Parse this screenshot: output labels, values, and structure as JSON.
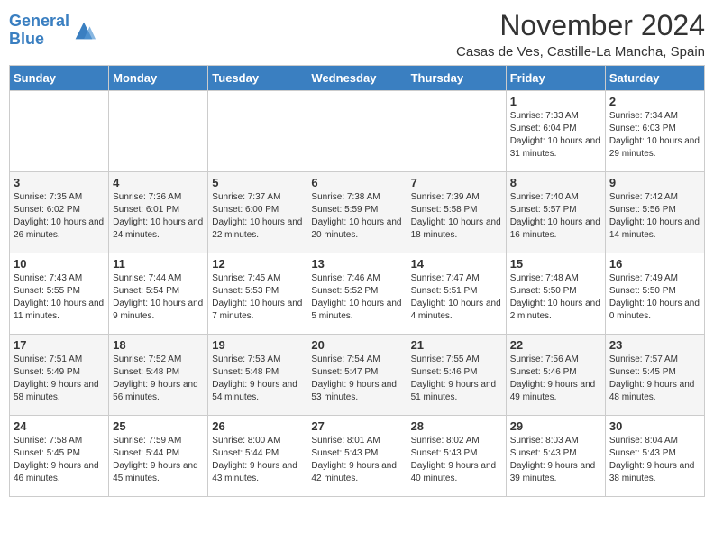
{
  "logo": {
    "line1": "General",
    "line2": "Blue"
  },
  "title": "November 2024",
  "location": "Casas de Ves, Castille-La Mancha, Spain",
  "weekdays": [
    "Sunday",
    "Monday",
    "Tuesday",
    "Wednesday",
    "Thursday",
    "Friday",
    "Saturday"
  ],
  "weeks": [
    [
      {
        "day": "",
        "info": ""
      },
      {
        "day": "",
        "info": ""
      },
      {
        "day": "",
        "info": ""
      },
      {
        "day": "",
        "info": ""
      },
      {
        "day": "",
        "info": ""
      },
      {
        "day": "1",
        "info": "Sunrise: 7:33 AM\nSunset: 6:04 PM\nDaylight: 10 hours and 31 minutes."
      },
      {
        "day": "2",
        "info": "Sunrise: 7:34 AM\nSunset: 6:03 PM\nDaylight: 10 hours and 29 minutes."
      }
    ],
    [
      {
        "day": "3",
        "info": "Sunrise: 7:35 AM\nSunset: 6:02 PM\nDaylight: 10 hours and 26 minutes."
      },
      {
        "day": "4",
        "info": "Sunrise: 7:36 AM\nSunset: 6:01 PM\nDaylight: 10 hours and 24 minutes."
      },
      {
        "day": "5",
        "info": "Sunrise: 7:37 AM\nSunset: 6:00 PM\nDaylight: 10 hours and 22 minutes."
      },
      {
        "day": "6",
        "info": "Sunrise: 7:38 AM\nSunset: 5:59 PM\nDaylight: 10 hours and 20 minutes."
      },
      {
        "day": "7",
        "info": "Sunrise: 7:39 AM\nSunset: 5:58 PM\nDaylight: 10 hours and 18 minutes."
      },
      {
        "day": "8",
        "info": "Sunrise: 7:40 AM\nSunset: 5:57 PM\nDaylight: 10 hours and 16 minutes."
      },
      {
        "day": "9",
        "info": "Sunrise: 7:42 AM\nSunset: 5:56 PM\nDaylight: 10 hours and 14 minutes."
      }
    ],
    [
      {
        "day": "10",
        "info": "Sunrise: 7:43 AM\nSunset: 5:55 PM\nDaylight: 10 hours and 11 minutes."
      },
      {
        "day": "11",
        "info": "Sunrise: 7:44 AM\nSunset: 5:54 PM\nDaylight: 10 hours and 9 minutes."
      },
      {
        "day": "12",
        "info": "Sunrise: 7:45 AM\nSunset: 5:53 PM\nDaylight: 10 hours and 7 minutes."
      },
      {
        "day": "13",
        "info": "Sunrise: 7:46 AM\nSunset: 5:52 PM\nDaylight: 10 hours and 5 minutes."
      },
      {
        "day": "14",
        "info": "Sunrise: 7:47 AM\nSunset: 5:51 PM\nDaylight: 10 hours and 4 minutes."
      },
      {
        "day": "15",
        "info": "Sunrise: 7:48 AM\nSunset: 5:50 PM\nDaylight: 10 hours and 2 minutes."
      },
      {
        "day": "16",
        "info": "Sunrise: 7:49 AM\nSunset: 5:50 PM\nDaylight: 10 hours and 0 minutes."
      }
    ],
    [
      {
        "day": "17",
        "info": "Sunrise: 7:51 AM\nSunset: 5:49 PM\nDaylight: 9 hours and 58 minutes."
      },
      {
        "day": "18",
        "info": "Sunrise: 7:52 AM\nSunset: 5:48 PM\nDaylight: 9 hours and 56 minutes."
      },
      {
        "day": "19",
        "info": "Sunrise: 7:53 AM\nSunset: 5:48 PM\nDaylight: 9 hours and 54 minutes."
      },
      {
        "day": "20",
        "info": "Sunrise: 7:54 AM\nSunset: 5:47 PM\nDaylight: 9 hours and 53 minutes."
      },
      {
        "day": "21",
        "info": "Sunrise: 7:55 AM\nSunset: 5:46 PM\nDaylight: 9 hours and 51 minutes."
      },
      {
        "day": "22",
        "info": "Sunrise: 7:56 AM\nSunset: 5:46 PM\nDaylight: 9 hours and 49 minutes."
      },
      {
        "day": "23",
        "info": "Sunrise: 7:57 AM\nSunset: 5:45 PM\nDaylight: 9 hours and 48 minutes."
      }
    ],
    [
      {
        "day": "24",
        "info": "Sunrise: 7:58 AM\nSunset: 5:45 PM\nDaylight: 9 hours and 46 minutes."
      },
      {
        "day": "25",
        "info": "Sunrise: 7:59 AM\nSunset: 5:44 PM\nDaylight: 9 hours and 45 minutes."
      },
      {
        "day": "26",
        "info": "Sunrise: 8:00 AM\nSunset: 5:44 PM\nDaylight: 9 hours and 43 minutes."
      },
      {
        "day": "27",
        "info": "Sunrise: 8:01 AM\nSunset: 5:43 PM\nDaylight: 9 hours and 42 minutes."
      },
      {
        "day": "28",
        "info": "Sunrise: 8:02 AM\nSunset: 5:43 PM\nDaylight: 9 hours and 40 minutes."
      },
      {
        "day": "29",
        "info": "Sunrise: 8:03 AM\nSunset: 5:43 PM\nDaylight: 9 hours and 39 minutes."
      },
      {
        "day": "30",
        "info": "Sunrise: 8:04 AM\nSunset: 5:43 PM\nDaylight: 9 hours and 38 minutes."
      }
    ]
  ]
}
